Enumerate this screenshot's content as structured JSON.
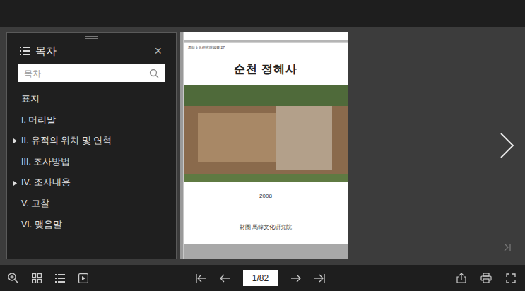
{
  "toc": {
    "title": "목차",
    "close": "×",
    "search": {
      "placeholder": "목차"
    },
    "items": [
      {
        "label": "표지",
        "expandable": false
      },
      {
        "label": "I. 머리말",
        "expandable": false
      },
      {
        "label": "II. 유적의 위치 및 연혁",
        "expandable": true
      },
      {
        "label": "III. 조사방법",
        "expandable": false
      },
      {
        "label": "IV. 조사내용",
        "expandable": true
      },
      {
        "label": "V. 고찰",
        "expandable": false
      },
      {
        "label": "VI. 맺음말",
        "expandable": false
      }
    ]
  },
  "page": {
    "series": "馬韓文化硏究院叢書 27",
    "title": "순천 정혜사",
    "year": "2008",
    "publisher": "財團 馬韓文化硏究院"
  },
  "pager": {
    "current": "1/82"
  }
}
